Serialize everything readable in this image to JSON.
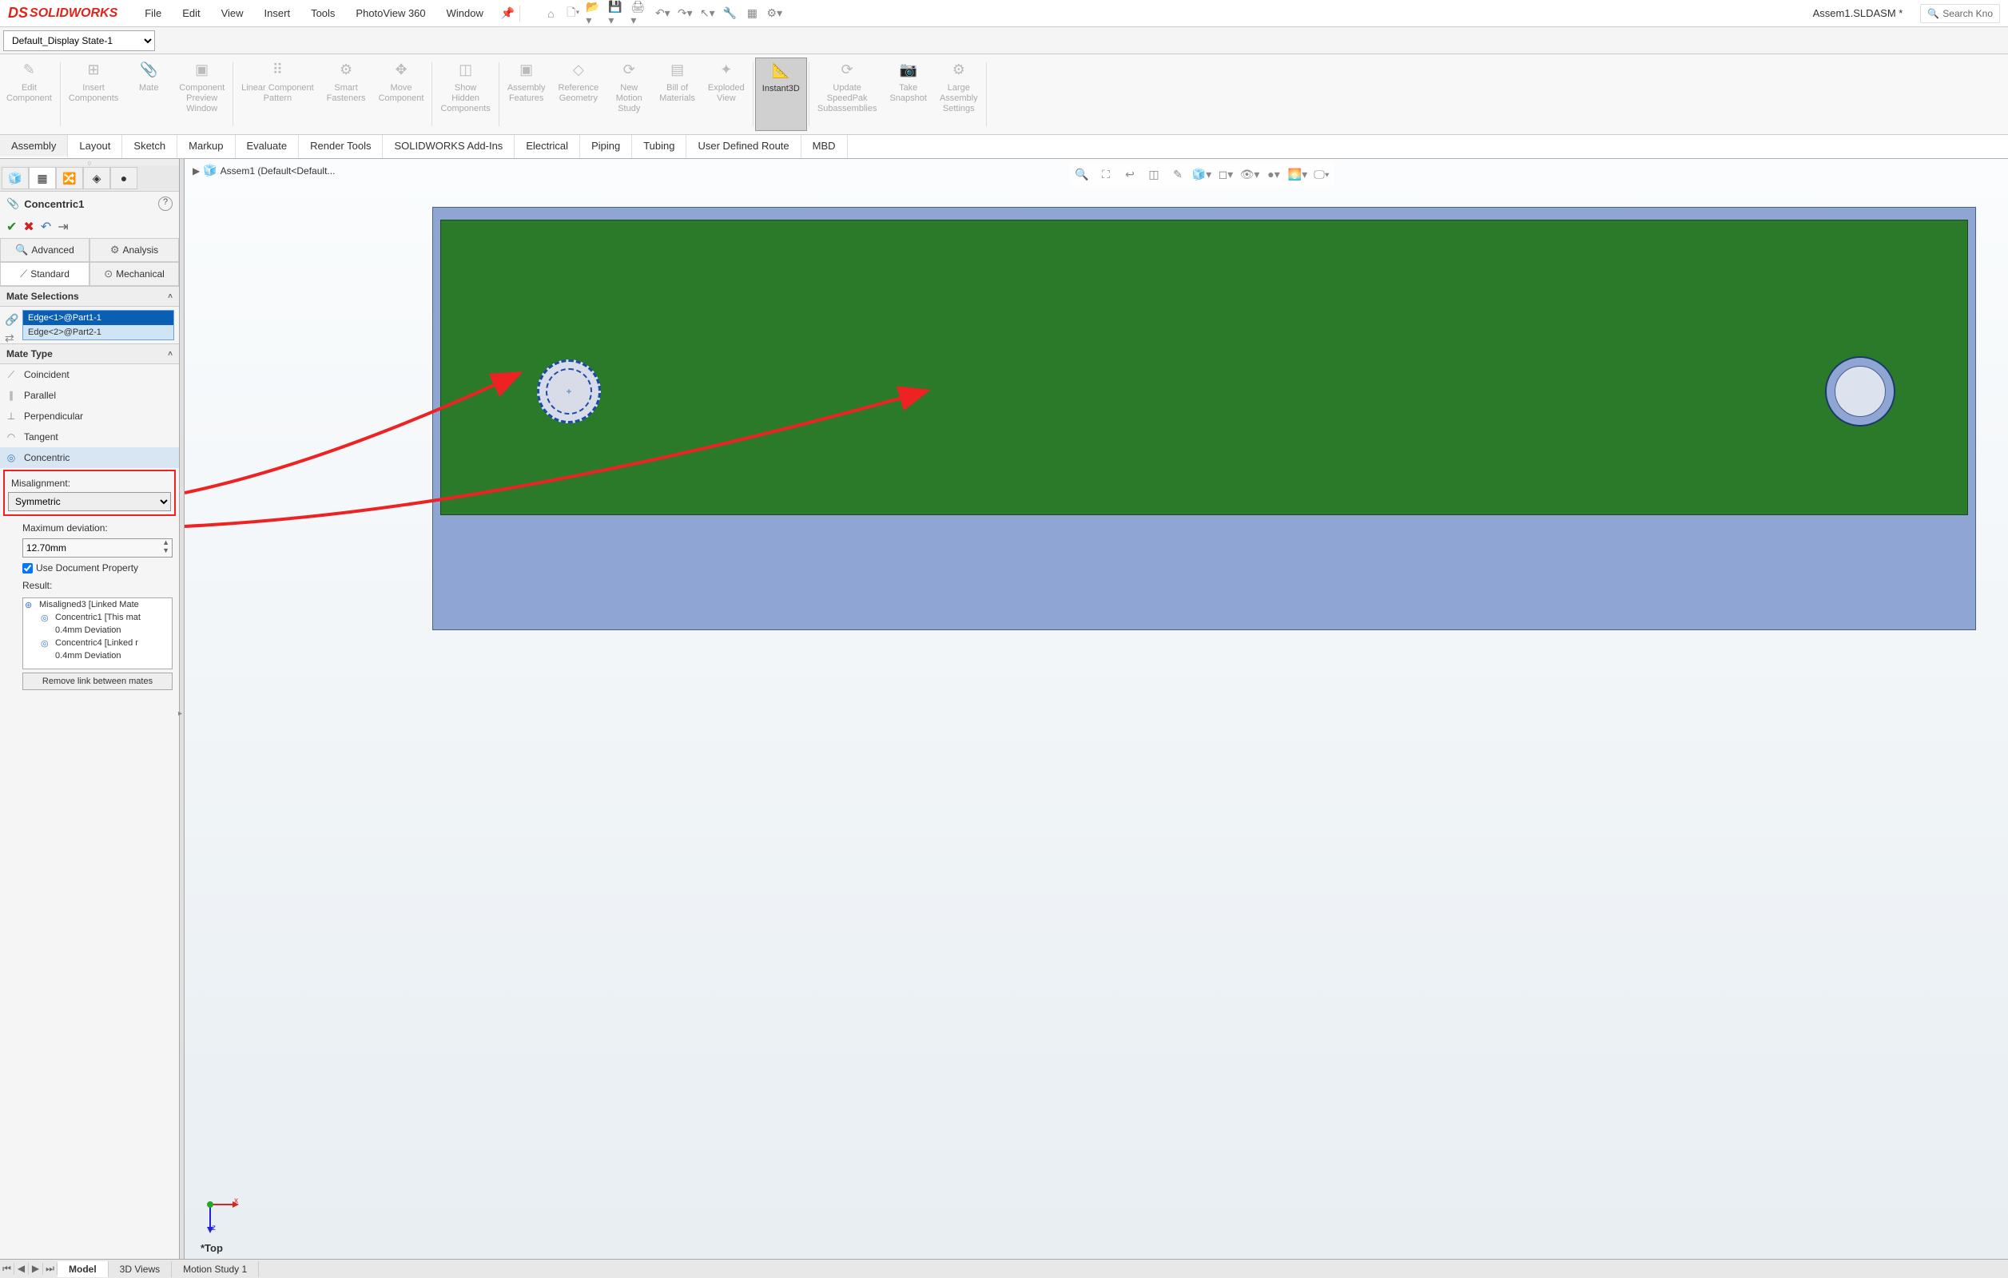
{
  "app": {
    "logo": "SOLIDWORKS",
    "menus": [
      "File",
      "Edit",
      "View",
      "Insert",
      "Tools",
      "PhotoView 360",
      "Window"
    ],
    "doc_title": "Assem1.SLDASM *",
    "search_placeholder": "Search Kno"
  },
  "display_state": "Default_Display State-1",
  "ribbon": {
    "buttons": [
      {
        "label": "Edit\nComponent",
        "icon": "✎"
      },
      {
        "label": "Insert\nComponents",
        "icon": "⊞"
      },
      {
        "label": "Mate",
        "icon": "📎"
      },
      {
        "label": "Component\nPreview\nWindow",
        "icon": "▣"
      },
      {
        "label": "Linear Component\nPattern",
        "icon": "⠿"
      },
      {
        "label": "Smart\nFasteners",
        "icon": "⚙"
      },
      {
        "label": "Move\nComponent",
        "icon": "✥"
      },
      {
        "label": "Show\nHidden\nComponents",
        "icon": "◫"
      },
      {
        "label": "Assembly\nFeatures",
        "icon": "▣"
      },
      {
        "label": "Reference\nGeometry",
        "icon": "◇"
      },
      {
        "label": "New\nMotion\nStudy",
        "icon": "⟳"
      },
      {
        "label": "Bill of\nMaterials",
        "icon": "▤"
      },
      {
        "label": "Exploded\nView",
        "icon": "✦"
      },
      {
        "label": "Instant3D",
        "icon": "📐",
        "active": true
      },
      {
        "label": "Update\nSpeedPak\nSubassemblies",
        "icon": "⟳"
      },
      {
        "label": "Take\nSnapshot",
        "icon": "📷"
      },
      {
        "label": "Large\nAssembly\nSettings",
        "icon": "⚙"
      }
    ],
    "tabs": [
      "Assembly",
      "Layout",
      "Sketch",
      "Markup",
      "Evaluate",
      "Render Tools",
      "SOLIDWORKS Add-Ins",
      "Electrical",
      "Piping",
      "Tubing",
      "User Defined Route",
      "MBD"
    ],
    "active_tab": "Assembly"
  },
  "prop": {
    "title": "Concentric1",
    "tab_row1": [
      "Advanced",
      "Analysis"
    ],
    "tab_row2": [
      "Standard",
      "Mechanical"
    ],
    "sections": {
      "mate_selections": "Mate Selections",
      "mate_type": "Mate Type"
    },
    "selections": [
      {
        "label": "Edge<1>@Part1-1",
        "active": true
      },
      {
        "label": "Edge<2>@Part2-1",
        "active": false
      }
    ],
    "mate_types": [
      {
        "label": "Coincident",
        "icon": "⟋"
      },
      {
        "label": "Parallel",
        "icon": "∥"
      },
      {
        "label": "Perpendicular",
        "icon": "⊥"
      },
      {
        "label": "Tangent",
        "icon": "◠"
      },
      {
        "label": "Concentric",
        "icon": "◎",
        "selected": true
      }
    ],
    "misalignment": {
      "label": "Misalignment:",
      "value": "Symmetric"
    },
    "max_dev": {
      "label": "Maximum deviation:",
      "value": "12.70mm"
    },
    "use_doc_prop": "Use Document Property",
    "result_label": "Result:",
    "result_tree": [
      {
        "label": "Misaligned3 [Linked Mate",
        "level": 1,
        "icon": "⊛"
      },
      {
        "label": "Concentric1 [This mat",
        "level": 2,
        "icon": "◎"
      },
      {
        "label": "0.4mm Deviation",
        "level": 2,
        "icon": ""
      },
      {
        "label": "Concentric4 [Linked r",
        "level": 2,
        "icon": "◎"
      },
      {
        "label": "0.4mm Deviation",
        "level": 2,
        "icon": ""
      }
    ],
    "remove_link": "Remove link between mates"
  },
  "breadcrumb": "Assem1  (Default<Default...",
  "triad_label": "*Top",
  "bottom_tabs": [
    "Model",
    "3D Views",
    "Motion Study 1"
  ],
  "active_bottom_tab": "Model"
}
